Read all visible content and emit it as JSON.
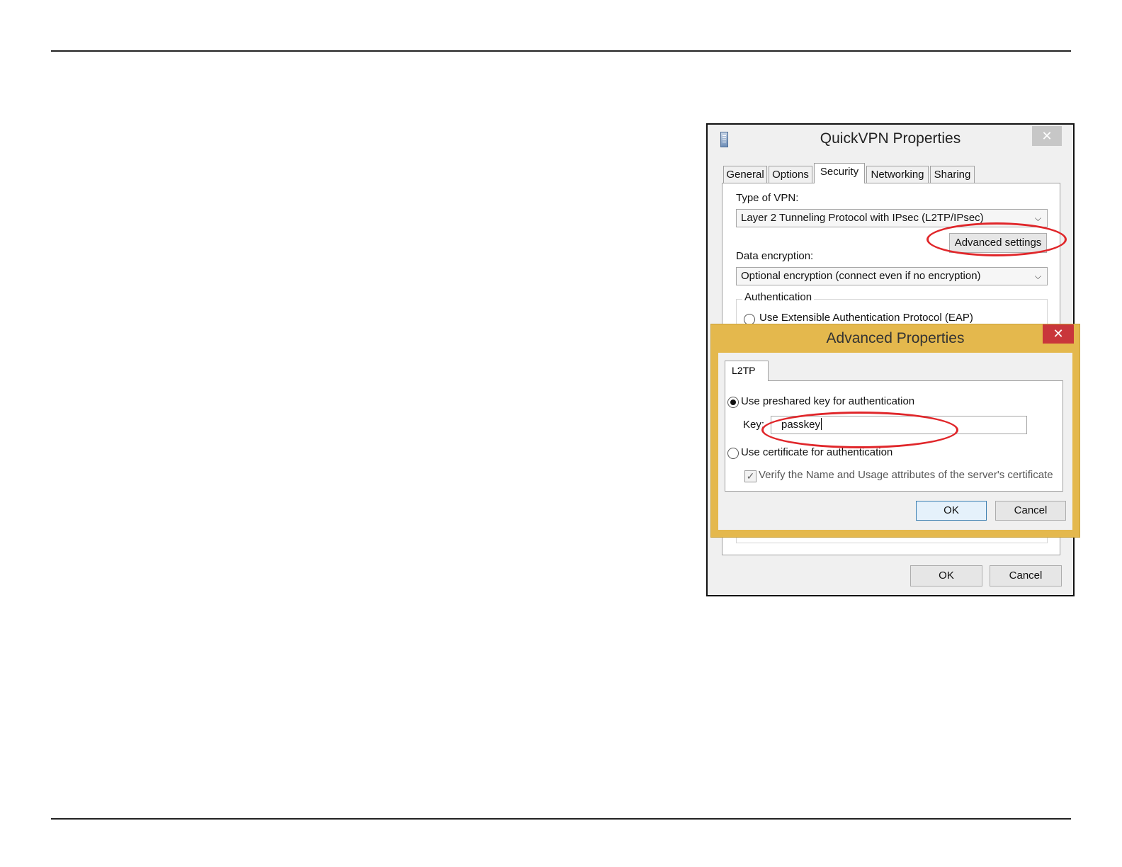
{
  "quickvpn": {
    "title": "QuickVPN Properties",
    "close_label": "✕",
    "tabs": [
      {
        "label": "General"
      },
      {
        "label": "Options"
      },
      {
        "label": "Security"
      },
      {
        "label": "Networking"
      },
      {
        "label": "Sharing"
      }
    ],
    "active_tab": "Security",
    "type_of_vpn_label": "Type of VPN:",
    "type_of_vpn_value": "Layer 2 Tunneling Protocol with IPsec (L2TP/IPsec)",
    "advanced_settings_label": "Advanced settings",
    "data_encryption_label": "Data encryption:",
    "data_encryption_value": "Optional encryption (connect even if no encryption)",
    "authentication_label": "Authentication",
    "eap_option_label": "Use Extensible Authentication Protocol (EAP)",
    "ok_label": "OK",
    "cancel_label": "Cancel"
  },
  "advanced": {
    "title": "Advanced Properties",
    "close_label": "✕",
    "tab_label": "L2TP",
    "preshared_label": "Use preshared key for authentication",
    "key_label": "Key:",
    "key_value": "passkey",
    "certificate_label": "Use certificate for authentication",
    "verify_label": "Verify the Name and Usage attributes of the server's certificate",
    "ok_label": "OK",
    "cancel_label": "Cancel"
  },
  "colors": {
    "highlight": "#e0262a",
    "advanced_frame": "#e4b84d",
    "advanced_close": "#c9363b"
  }
}
